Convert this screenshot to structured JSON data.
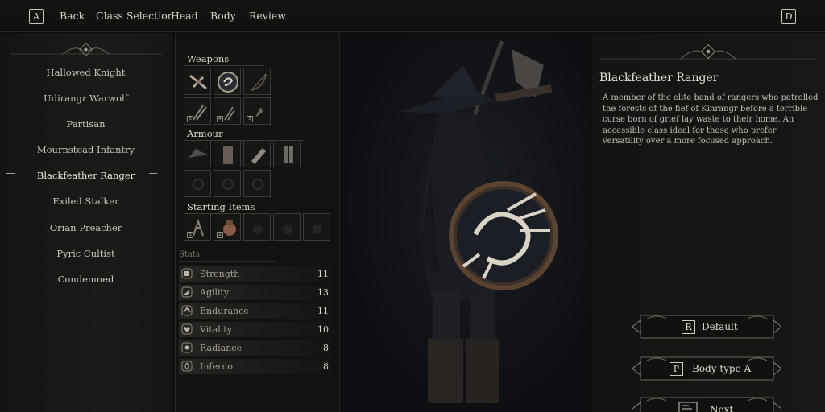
{
  "topbar": {
    "left_key": "A",
    "right_key": "D",
    "nav": [
      "Back",
      "Class Selection",
      "Head",
      "Body",
      "Review"
    ],
    "active": "Class Selection"
  },
  "classes": [
    {
      "name": "Hallowed Knight",
      "selected": false
    },
    {
      "name": "Udirangr Warwolf",
      "selected": false
    },
    {
      "name": "Partisan",
      "selected": false
    },
    {
      "name": "Mournstead Infantry",
      "selected": false
    },
    {
      "name": "Blackfeather Ranger",
      "selected": true
    },
    {
      "name": "Exiled Stalker",
      "selected": false
    },
    {
      "name": "Orian Preacher",
      "selected": false
    },
    {
      "name": "Pyric Cultist",
      "selected": false
    },
    {
      "name": "Condemned",
      "selected": false
    }
  ],
  "equipment": {
    "weapons_title": "Weapons",
    "armour_title": "Armour",
    "starting_title": "Starting Items",
    "weapon_slots": [
      {
        "icon": "crossbow-icon",
        "num": ""
      },
      {
        "icon": "shield-icon",
        "num": ""
      },
      {
        "icon": "bow-icon",
        "num": ""
      },
      {
        "icon": "bolts-icon",
        "num": "3"
      },
      {
        "icon": "arrows-icon",
        "num": "4"
      },
      {
        "icon": "arrowhead-icon",
        "num": "5"
      }
    ],
    "armour_slots": [
      {
        "icon": "hat-icon"
      },
      {
        "icon": "coat-icon"
      },
      {
        "icon": "gauntlets-icon"
      },
      {
        "icon": "boots-icon"
      },
      {
        "icon": "empty-ring-icon"
      },
      {
        "icon": "empty-ring-icon"
      },
      {
        "icon": "empty-ring-icon"
      }
    ],
    "starting_slots": [
      {
        "icon": "herb-icon",
        "num": "5"
      },
      {
        "icon": "pouch-icon",
        "num": "2"
      },
      {
        "icon": "empty-bag-icon",
        "num": ""
      },
      {
        "icon": "empty-bag-icon",
        "num": ""
      },
      {
        "icon": "empty-bag-icon",
        "num": ""
      }
    ]
  },
  "stats": {
    "label": "Stats",
    "rows": [
      {
        "name": "Strength",
        "value": "11",
        "icon": "fist-icon"
      },
      {
        "name": "Agility",
        "value": "13",
        "icon": "wing-icon"
      },
      {
        "name": "Endurance",
        "value": "11",
        "icon": "endurance-icon"
      },
      {
        "name": "Vitality",
        "value": "10",
        "icon": "heart-icon"
      },
      {
        "name": "Radiance",
        "value": "8",
        "icon": "radiance-icon"
      },
      {
        "name": "Inferno",
        "value": "8",
        "icon": "flame-icon"
      }
    ]
  },
  "description": {
    "title": "Blackfeather Ranger",
    "text": "A member of the elite band of rangers who patrolled the forests of the fief of Kinrangr before a terrible curse born of grief lay waste to their home. An accessible class ideal for those who prefer versatility over a more focused approach."
  },
  "actions": [
    {
      "key": "R",
      "label": "Default"
    },
    {
      "key": "P",
      "label": "Body type A"
    },
    {
      "key": "",
      "label": "Next"
    }
  ],
  "colors": {
    "accent": "#d8d2c4",
    "background": "#0d0d0c",
    "frame": "#6d685d"
  }
}
